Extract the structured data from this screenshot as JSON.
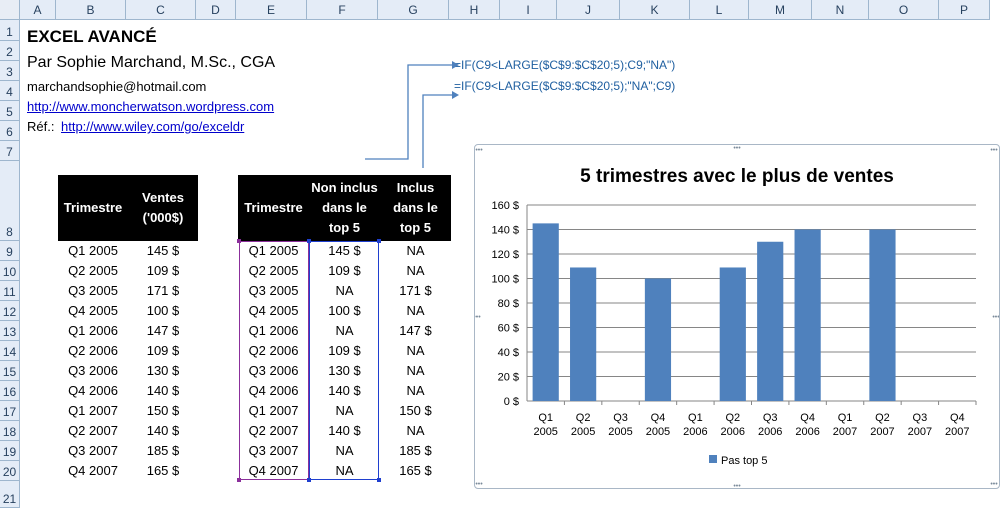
{
  "columns": [
    "A",
    "B",
    "C",
    "D",
    "E",
    "F",
    "G",
    "H",
    "I",
    "J",
    "K",
    "L",
    "M",
    "N",
    "O",
    "P"
  ],
  "rows": [
    "1",
    "2",
    "3",
    "4",
    "5",
    "6",
    "7",
    "8",
    "9",
    "10",
    "11",
    "12",
    "13",
    "14",
    "15",
    "16",
    "17",
    "18",
    "19",
    "20",
    "21"
  ],
  "header_block": {
    "title": "EXCEL AVANCÉ",
    "author": "Par Sophie Marchand, M.Sc., CGA",
    "email": "marchandsophie@hotmail.com",
    "website": "http://www.moncherwatson.wordpress.com",
    "ref_label": "Réf.:",
    "ref_link": "http://www.wiley.com/go/exceldr"
  },
  "formulas": {
    "f1": "=IF(C9<LARGE($C$9:$C$20;5);C9;\"NA\")",
    "f2": "=IF(C9<LARGE($C$9:$C$20;5);\"NA\";C9)"
  },
  "table1": {
    "headers": [
      "Trimestre",
      "Ventes ('000$)"
    ],
    "rows": [
      [
        "Q1 2005",
        "145 $"
      ],
      [
        "Q2 2005",
        "109 $"
      ],
      [
        "Q3 2005",
        "171 $"
      ],
      [
        "Q4 2005",
        "100 $"
      ],
      [
        "Q1 2006",
        "147 $"
      ],
      [
        "Q2 2006",
        "109 $"
      ],
      [
        "Q3 2006",
        "130 $"
      ],
      [
        "Q4 2006",
        "140 $"
      ],
      [
        "Q1 2007",
        "150 $"
      ],
      [
        "Q2 2007",
        "140 $"
      ],
      [
        "Q3 2007",
        "185 $"
      ],
      [
        "Q4 2007",
        "165 $"
      ]
    ]
  },
  "table2": {
    "headers": [
      "Trimestre",
      "Non inclus dans le top 5",
      "Inclus dans le top 5"
    ],
    "rows": [
      [
        "Q1 2005",
        "145 $",
        "NA"
      ],
      [
        "Q2 2005",
        "109 $",
        "NA"
      ],
      [
        "Q3 2005",
        "NA",
        "171 $"
      ],
      [
        "Q4 2005",
        "100 $",
        "NA"
      ],
      [
        "Q1 2006",
        "NA",
        "147 $"
      ],
      [
        "Q2 2006",
        "109 $",
        "NA"
      ],
      [
        "Q3 2006",
        "130 $",
        "NA"
      ],
      [
        "Q4 2006",
        "140 $",
        "NA"
      ],
      [
        "Q1 2007",
        "NA",
        "150 $"
      ],
      [
        "Q2 2007",
        "140 $",
        "NA"
      ],
      [
        "Q3 2007",
        "NA",
        "185 $"
      ],
      [
        "Q4 2007",
        "NA",
        "165 $"
      ]
    ]
  },
  "colors": {
    "bar": "#4f81bd",
    "header_bg": "#000000",
    "formula": "#1f5fa0",
    "link": "#0000cc"
  },
  "chart_data": {
    "type": "bar",
    "title": "5 trimestres avec le plus de ventes",
    "categories": [
      "Q1 2005",
      "Q2 2005",
      "Q3 2005",
      "Q4 2005",
      "Q1 2006",
      "Q2 2006",
      "Q3 2006",
      "Q4 2006",
      "Q1 2007",
      "Q2 2007",
      "Q3 2007",
      "Q4 2007"
    ],
    "series": [
      {
        "name": "Pas top 5",
        "values": [
          145,
          109,
          null,
          100,
          null,
          109,
          130,
          140,
          null,
          140,
          null,
          null
        ]
      }
    ],
    "yticks": [
      "0 $",
      "20 $",
      "40 $",
      "60 $",
      "80 $",
      "100 $",
      "120 $",
      "140 $",
      "160 $"
    ],
    "ylim": [
      0,
      160
    ],
    "grid": true,
    "legend": "bottom"
  }
}
